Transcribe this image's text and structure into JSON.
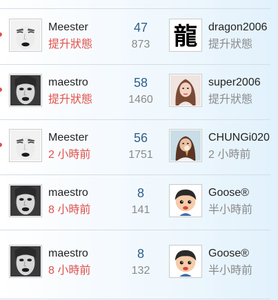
{
  "rows": [
    {
      "left_user": {
        "name": "Meester",
        "time": "提升狀態",
        "avatar": "face-squint-avatar"
      },
      "replies": "47",
      "views": "873",
      "right_user": {
        "name": "dragon2006",
        "time": "提升狀態",
        "avatar": "dragon-character-avatar",
        "glyph": "龍"
      }
    },
    {
      "left_user": {
        "name": "maestro",
        "time": "提升狀態",
        "avatar": "face-dark-lips-avatar"
      },
      "replies": "58",
      "views": "1460",
      "right_user": {
        "name": "super2006",
        "time": "提升狀態",
        "avatar": "woman-photo-avatar"
      }
    },
    {
      "left_user": {
        "name": "Meester",
        "time": "2 小時前",
        "avatar": "face-squint-avatar"
      },
      "replies": "56",
      "views": "1751",
      "right_user": {
        "name": "CHUNGi020",
        "time": "2 小時前",
        "avatar": "person-icecream-avatar"
      }
    },
    {
      "left_user": {
        "name": "maestro",
        "time": "8 小時前",
        "avatar": "face-dark-lips-avatar"
      },
      "replies": "8",
      "views": "141",
      "right_user": {
        "name": "Goose®",
        "time": "半小時前",
        "avatar": "cartoon-boy-avatar"
      }
    },
    {
      "left_user": {
        "name": "maestro",
        "time": "8 小時前",
        "avatar": "face-dark-lips-avatar"
      },
      "replies": "8",
      "views": "132",
      "right_user": {
        "name": "Goose®",
        "time": "半小時前",
        "avatar": "cartoon-boy-avatar"
      }
    }
  ],
  "colors": {
    "time_highlight": "#e0504a",
    "count": "#2b5f8a",
    "muted": "#8a8a8a",
    "divider": "#d3dde4"
  }
}
